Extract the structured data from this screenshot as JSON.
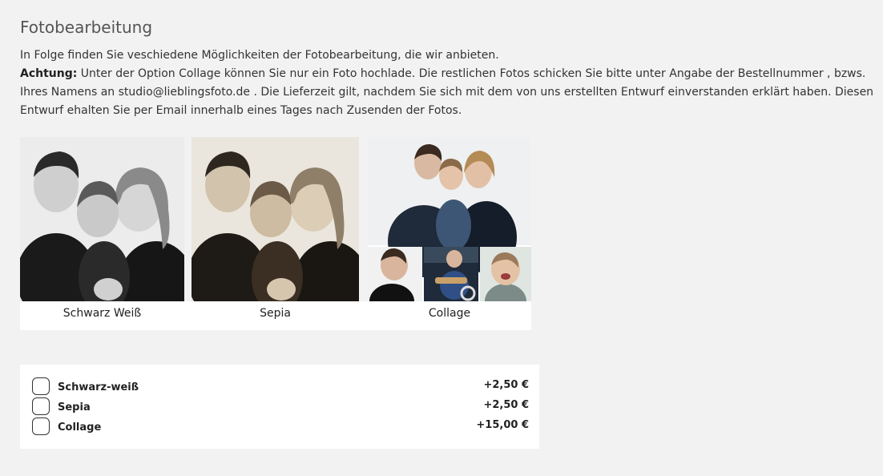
{
  "heading": "Fotobearbeitung",
  "intro": {
    "line1": "In Folge finden Sie veschiedene Möglichkeiten der Fotobearbeitung, die wir anbieten.",
    "warning_label": "Achtung:",
    "warning_text": " Unter der Option Collage können Sie nur ein Foto hochlade. Die restlichen Fotos schicken Sie bitte unter Angabe der Bestellnummer , bzws. Ihres Namens an studio@lieblingsfoto.de . Die Lieferzeit gilt, nachdem Sie sich mit dem von uns erstellten Entwurf einverstanden erklärt haben. Diesen Entwurf ehalten Sie per Email innerhalb eines Tages nach Zusenden der Fotos."
  },
  "gallery": [
    {
      "caption": "Schwarz Weiß"
    },
    {
      "caption": "Sepia"
    },
    {
      "caption": "Collage"
    }
  ],
  "options": [
    {
      "label": "Schwarz-weiß",
      "price": "+2,50 €",
      "checked": false
    },
    {
      "label": "Sepia",
      "price": "+2,50 €",
      "checked": false
    },
    {
      "label": "Collage",
      "price": "+15,00 €",
      "checked": false
    }
  ]
}
